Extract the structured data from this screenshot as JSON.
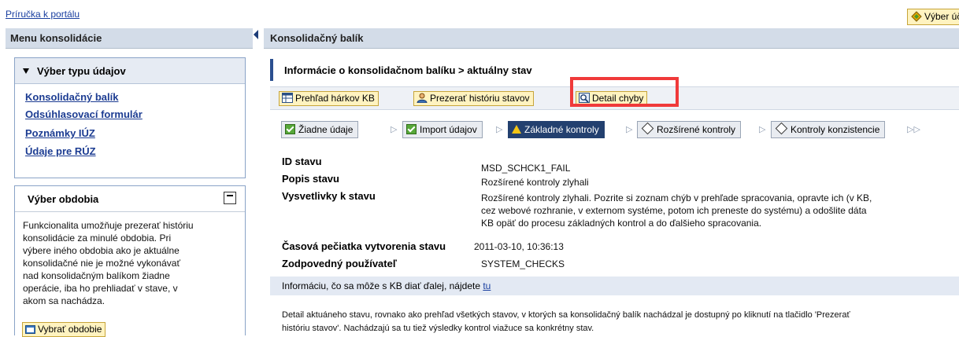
{
  "top": {
    "guide_link": "Príručka k portálu",
    "account_button": "Výber účt"
  },
  "left": {
    "header": "Menu konsolidácie",
    "type_section": {
      "title": "Výber typu údajov",
      "links": [
        "Konsolidačný balík",
        "Odsúhlasovací formulár",
        "Poznámky IÚZ",
        "Údaje pre RÚZ"
      ]
    },
    "period_section": {
      "title": "Výber obdobia",
      "description_lines": [
        "Funkcionalita umožňuje prezerať históriu",
        "konsolidácie za minulé obdobia. Pri",
        "výbere iného obdobia ako je aktuálne",
        "konsolidačné nie je možné vykonávať",
        "nad konsolidačným balíkom žiadne",
        "operácie, iba ho prehliadať v stave, v",
        "akom sa nachádza."
      ],
      "button": "Vybrať obdobie"
    }
  },
  "right": {
    "header": "Konsolidačný balík",
    "info_title": "Informácie o konsolidačnom balíku > aktuálny stav",
    "toolbar": {
      "overview": "Prehľad hárkov KB",
      "history": "Prezerať históriu stavov",
      "error_detail": "Detail chyby"
    },
    "steps": {
      "s1": "Žiadne údaje",
      "s2": "Import údajov",
      "s3": "Základné kontroly",
      "s4": "Rozšírené kontroly",
      "s5": "Kontroly konzistencie"
    },
    "details": {
      "id_label": "ID stavu",
      "id_value": "MSD_SCHCK1_FAIL",
      "desc_label": "Popis stavu",
      "desc_value": "Rozšírené kontroly zlyhali",
      "expl_label": "Vysvetlivky k stavu",
      "expl_lines": [
        "Rozšírené kontroly zlyhali. Pozrite si zoznam chýb v prehľade spracovania, opravte ich (v KB,",
        "cez webové rozhranie, v externom systéme, potom ich preneste do systému) a odošlite dáta",
        "KB opäť do procesu základných kontrol a do ďalšieho spracovania."
      ],
      "time_label": "Časová pečiatka vytvorenia stavu",
      "time_value": "2011-03-10, 10:36:13",
      "user_label": "Zodpovedný používateľ",
      "user_value": "SYSTEM_CHECKS"
    },
    "next_text": "Informáciu, čo sa môže s KB diať ďalej, nájdete ",
    "next_link": "tu",
    "footer_lines": [
      "Detail aktuáneho stavu, rovnako ako prehľad všetkých stavov, v ktorých sa konsolidačný balík nachádzal je dostupný po kliknutí na tlačidlo 'Prezerať",
      "históriu stavov'. Nachádzajú sa tu tiež výsledky kontrol viažuce sa konkrétny stav."
    ]
  }
}
